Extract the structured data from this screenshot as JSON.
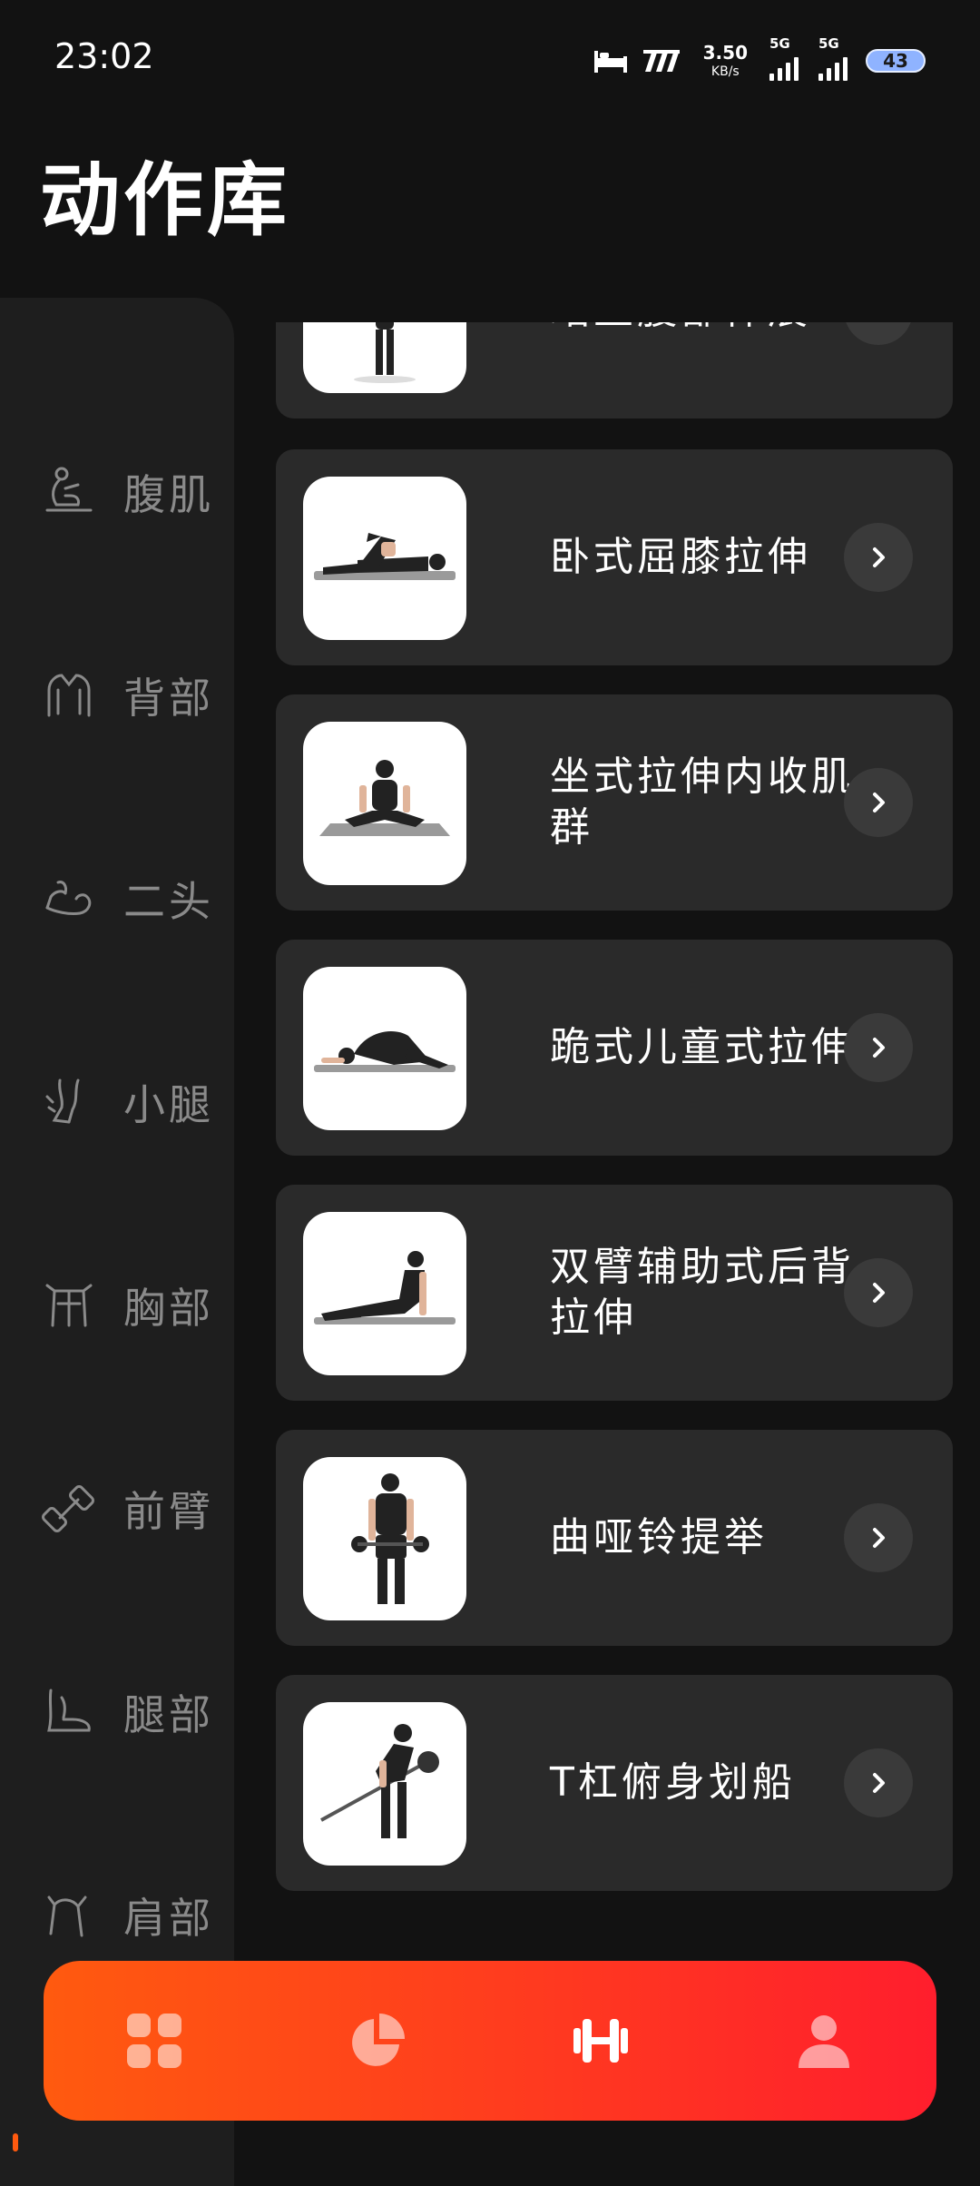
{
  "status_bar": {
    "time": "23:02",
    "net_speed_value": "3.50",
    "net_speed_unit": "KB/s",
    "signal1_label": "5G",
    "signal2_label": "5G",
    "battery": "43",
    "icons": [
      "bed-icon",
      "carrier-logo-icon",
      "signal-icon",
      "signal-icon",
      "battery-icon"
    ]
  },
  "page": {
    "title": "动作库"
  },
  "sidebar": {
    "categories": [
      {
        "label": "腹肌",
        "icon": "abs-icon"
      },
      {
        "label": "背部",
        "icon": "back-icon"
      },
      {
        "label": "二头",
        "icon": "biceps-icon"
      },
      {
        "label": "小腿",
        "icon": "calf-icon"
      },
      {
        "label": "胸部",
        "icon": "chest-icon"
      },
      {
        "label": "前臂",
        "icon": "forearm-icon"
      },
      {
        "label": "腿部",
        "icon": "legs-icon"
      },
      {
        "label": "肩部",
        "icon": "shoulders-icon"
      }
    ]
  },
  "exercises": {
    "partial_item": {
      "name": "站立腹部伸展"
    },
    "items": [
      {
        "name": "卧式屈膝拉伸"
      },
      {
        "name": "坐式拉伸内收肌群"
      },
      {
        "name": "跪式儿童式拉伸"
      },
      {
        "name": "双臂辅助式后背拉伸"
      },
      {
        "name": "曲哑铃提举"
      },
      {
        "name": "T杠俯身划船"
      }
    ]
  },
  "tabbar": {
    "tabs": [
      {
        "icon": "grid-icon",
        "active": false
      },
      {
        "icon": "pie-chart-icon",
        "active": false
      },
      {
        "icon": "dumbbell-icon",
        "active": true
      },
      {
        "icon": "profile-icon",
        "active": false
      }
    ],
    "colors": {
      "start": "#ff5a0f",
      "end": "#ff1e2d"
    }
  },
  "colors": {
    "background": "#121212",
    "sidebar": "#1e1e1e",
    "card": "#2a2a2a",
    "muted_text": "#8a8a8a"
  }
}
